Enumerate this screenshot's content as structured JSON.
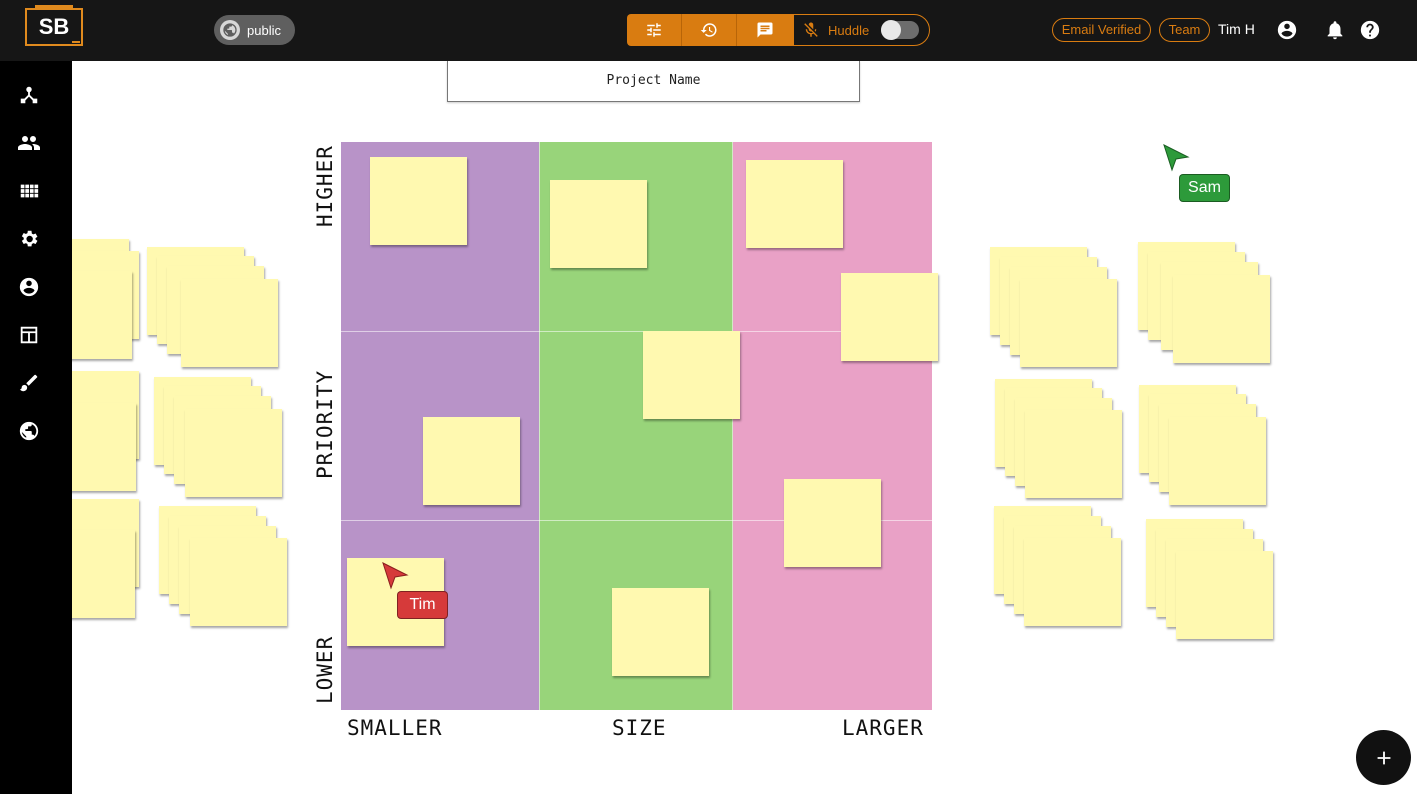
{
  "app": {
    "logo_text": "SB"
  },
  "header": {
    "visibility_label": "public",
    "huddle_label": "Huddle",
    "email_badge": "Email Verified",
    "team_badge": "Team",
    "user_name": "Tim H",
    "accent_color": "#d97c11"
  },
  "toolbar": {
    "buttons": [
      "sliders-icon",
      "history-icon",
      "chat-icon"
    ]
  },
  "sidebar": {
    "items": [
      "hub-icon",
      "people-icon",
      "apps-grid-icon",
      "settings-gear-icon",
      "account-icon",
      "table-layout-icon",
      "brush-icon",
      "globe-icon"
    ]
  },
  "board": {
    "project_name": "Project Name",
    "y_axis": {
      "top": "HIGHER",
      "middle": "PRIORITY",
      "bottom": "LOWER"
    },
    "x_axis": {
      "left": "SMALLER",
      "middle": "SIZE",
      "right": "LARGER"
    },
    "column_colors": [
      "#b893c8",
      "#98d47a",
      "#e9a1c6"
    ],
    "sticky_color": "#fff9b0"
  },
  "cursors": [
    {
      "name": "Tim",
      "color": "#d63a3a"
    },
    {
      "name": "Sam",
      "color": "#2d9a3a"
    }
  ]
}
